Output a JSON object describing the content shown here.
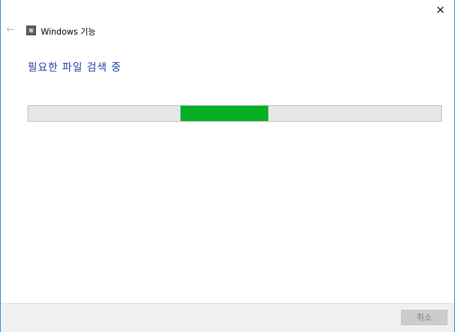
{
  "window": {
    "title": "Windows 기능",
    "close_icon": "close-icon",
    "back_icon": "back-arrow-icon"
  },
  "main": {
    "heading": "필요한 파일 검색 중",
    "progress": {
      "mode": "indeterminate-marquee",
      "fill_color": "#06b025"
    }
  },
  "footer": {
    "cancel_label": "취소"
  },
  "colors": {
    "accent_border": "#1883d7",
    "heading": "#1e3ea0"
  }
}
